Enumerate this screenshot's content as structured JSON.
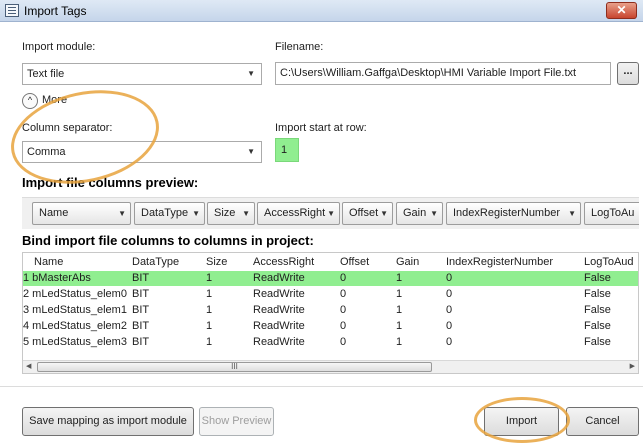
{
  "window": {
    "title": "Import Tags",
    "close_glyph": "✕"
  },
  "import_module": {
    "label": "Import module:",
    "value": "Text file"
  },
  "filename": {
    "label": "Filename:",
    "value": "C:\\Users\\William.Gaffga\\Desktop\\HMI Variable Import File.txt",
    "browse_label": "..."
  },
  "more": {
    "label": "More",
    "icon": "chevron-up-icon",
    "glyph": "^"
  },
  "column_separator": {
    "label": "Column separator:",
    "value": "Comma"
  },
  "import_start": {
    "label": "Import start at row:",
    "value": "1"
  },
  "preview": {
    "heading": "Import file columns preview:",
    "columns": [
      "Name",
      "DataType",
      "Size",
      "AccessRight",
      "Offset",
      "Gain",
      "IndexRegisterNumber",
      "LogToAu"
    ]
  },
  "bind": {
    "heading": "Bind import file columns to columns in project:",
    "headers": [
      "Name",
      "DataType",
      "Size",
      "AccessRight",
      "Offset",
      "Gain",
      "IndexRegisterNumber",
      "LogToAud"
    ],
    "rows": [
      [
        "1 bMasterAbs",
        "BIT",
        "1",
        "ReadWrite",
        "0",
        "1",
        "0",
        "False"
      ],
      [
        "2 mLedStatus_elem0",
        "BIT",
        "1",
        "ReadWrite",
        "0",
        "1",
        "0",
        "False"
      ],
      [
        "3 mLedStatus_elem1",
        "BIT",
        "1",
        "ReadWrite",
        "0",
        "1",
        "0",
        "False"
      ],
      [
        "4 mLedStatus_elem2",
        "BIT",
        "1",
        "ReadWrite",
        "0",
        "1",
        "0",
        "False"
      ],
      [
        "5 mLedStatus_elem3",
        "BIT",
        "1",
        "ReadWrite",
        "0",
        "1",
        "0",
        "False"
      ]
    ],
    "highlighted_row": 0,
    "scroll_thumb_glyph": "III"
  },
  "buttons": {
    "save_mapping": "Save mapping as import module",
    "show_preview": "Show Preview",
    "import": "Import",
    "cancel": "Cancel"
  },
  "colors": {
    "highlight_green": "#90ee90",
    "annotation_orange": "#e8a33d"
  }
}
